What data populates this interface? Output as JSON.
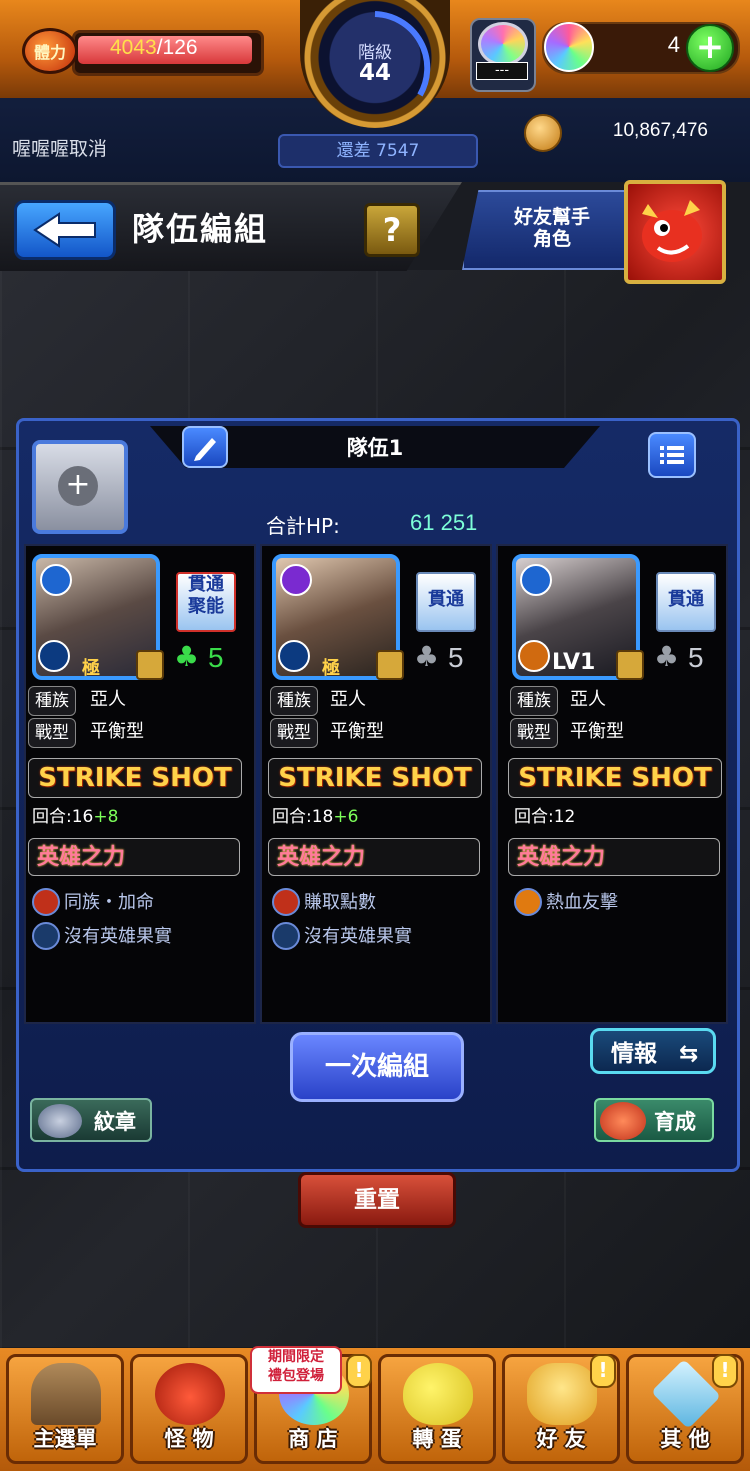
{
  "status": {
    "stamina_icon_label": "體力",
    "stamina_current": "4043",
    "stamina_max": "/126",
    "rank_label": "階級",
    "rank_value": "44",
    "rank_remaining": "還差 7547",
    "orb_box_text": "---",
    "gem_count": "4",
    "plus_label": "+",
    "username": "喔喔喔取消",
    "gold": "10,867,476"
  },
  "header": {
    "title": "隊伍編組",
    "help_label": "?",
    "friend_helper_label_1": "好友幫手",
    "friend_helper_label_2": "角色"
  },
  "team": {
    "name": "隊伍1",
    "total_hp_label": "合計HP:",
    "total_hp_value": "61 251",
    "add_slot_label": "+"
  },
  "cards": [
    {
      "badge": "極",
      "gimmick_1": "貫通",
      "gimmick_2": "聚能",
      "luck": "5",
      "race_label": "種族",
      "race": "亞人",
      "type_label": "戰型",
      "type": "平衡型",
      "strike_shot": "STRIKE SHOT",
      "turn_label": "回合:16",
      "turn_bonus": "+8",
      "hero_power": "英雄之力",
      "fruit_1": "同族・加命",
      "fruit_2": "沒有英雄果實"
    },
    {
      "badge": "極",
      "gimmick_1": "貫通",
      "gimmick_2": "",
      "luck": "5",
      "race_label": "種族",
      "race": "亞人",
      "type_label": "戰型",
      "type": "平衡型",
      "strike_shot": "STRIKE SHOT",
      "turn_label": "回合:18",
      "turn_bonus": "+6",
      "hero_power": "英雄之力",
      "fruit_1": "賺取點數",
      "fruit_2": "沒有英雄果實"
    },
    {
      "badge": "LV1",
      "gimmick_1": "貫通",
      "gimmick_2": "",
      "luck": "5",
      "race_label": "種族",
      "race": "亞人",
      "type_label": "戰型",
      "type": "平衡型",
      "strike_shot": "STRIKE SHOT",
      "turn_label": "回合:12",
      "turn_bonus": "",
      "hero_power": "英雄之力",
      "fruit_1": "熱血友擊",
      "fruit_2": ""
    }
  ],
  "actions": {
    "bulk_edit": "一次編組",
    "info": "情報",
    "emblem": "紋章",
    "train": "育成",
    "reset": "重置"
  },
  "nav": {
    "promo_line_1": "期間限定",
    "promo_line_2": "禮包登場",
    "items": [
      {
        "label": "主選單",
        "icon": "gate-icon"
      },
      {
        "label": "怪 物",
        "icon": "monster-icon"
      },
      {
        "label": "商 店",
        "icon": "shop-icon"
      },
      {
        "label": "轉 蛋",
        "icon": "egg-icon"
      },
      {
        "label": "好 友",
        "icon": "friends-icon"
      },
      {
        "label": "其 他",
        "icon": "other-icon"
      }
    ]
  },
  "colors": {
    "accent_orange": "#e88a24",
    "panel_blue": "#152a66",
    "hp_green": "#7dffd8",
    "strike_gold": "#ffd24a"
  }
}
